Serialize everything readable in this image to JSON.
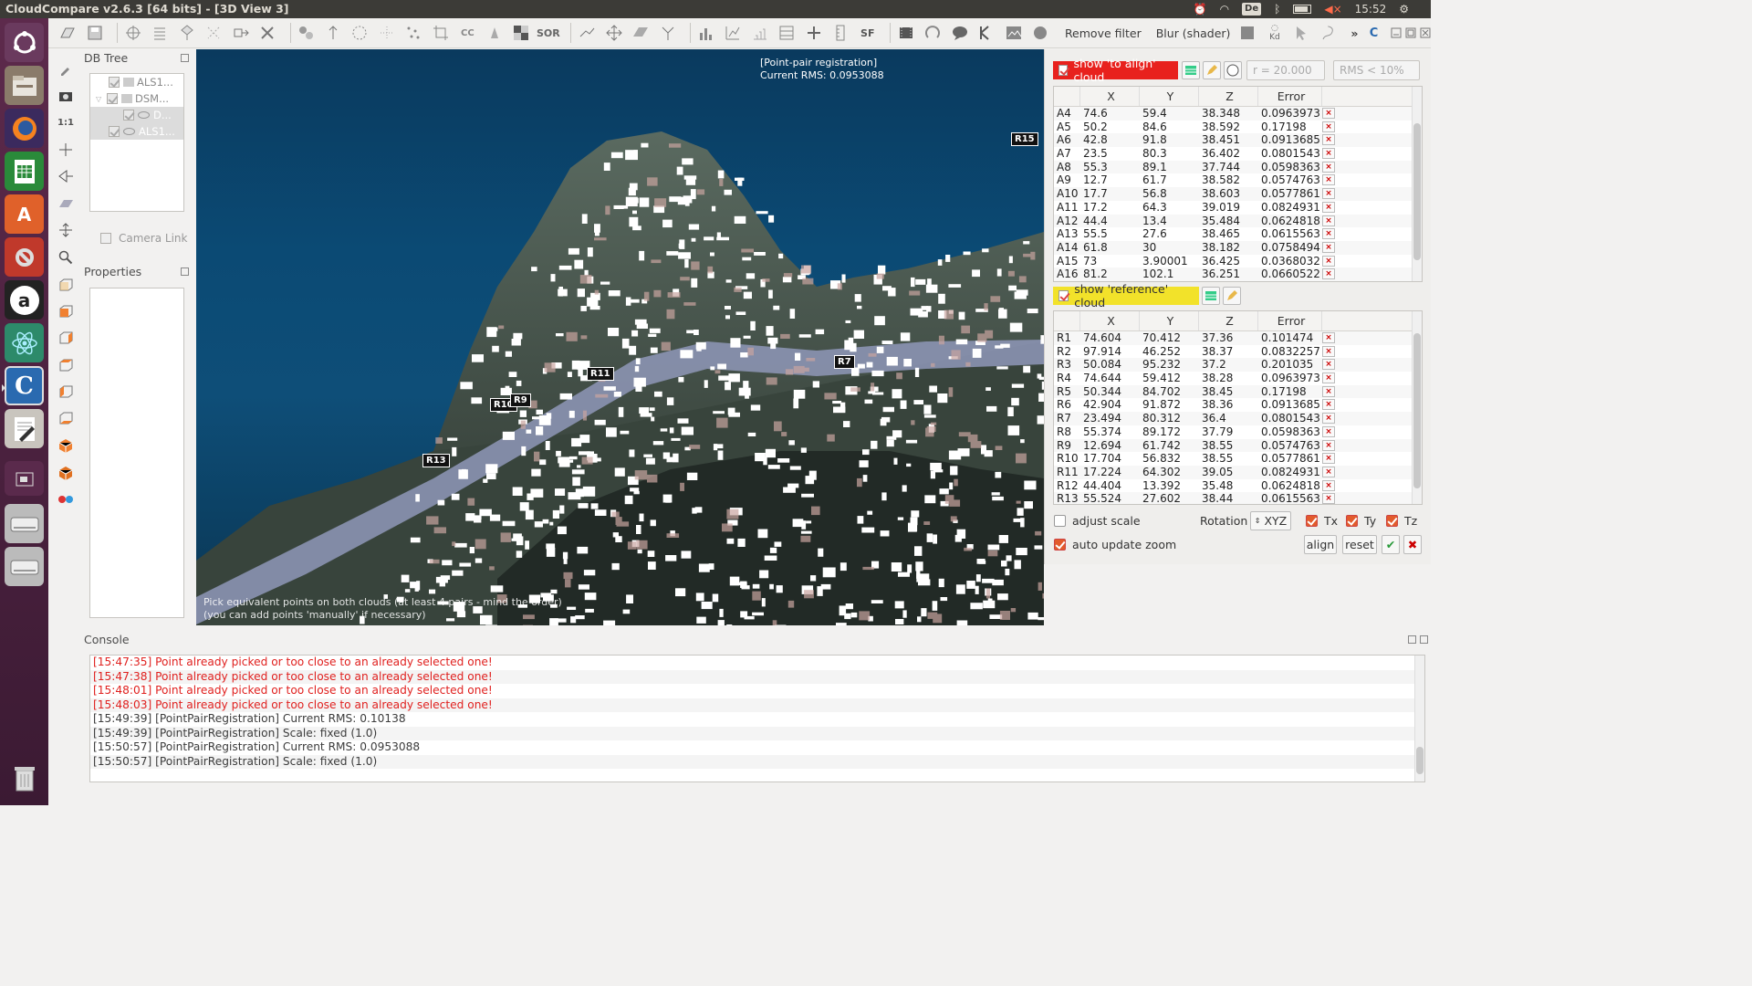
{
  "window": {
    "title": "CloudCompare v2.6.3 [64 bits] - [3D View 3]",
    "keyboard_layout": "De",
    "clock": "15:52"
  },
  "toolbar": {
    "remove_filter": "Remove filter",
    "blur_shader": "Blur (shader)",
    "kd_label": "Kd",
    "overflow": "»"
  },
  "dbtree": {
    "title": "DB Tree",
    "items": [
      {
        "label": "ALS1..."
      },
      {
        "label": "DSM..."
      },
      {
        "label": "D..."
      },
      {
        "label": "ALS1..."
      }
    ],
    "camera_link": "Camera Link"
  },
  "properties": {
    "title": "Properties"
  },
  "view3d": {
    "overlay_title": "[Point-pair registration]",
    "overlay_rms": "Current RMS: 0.0953088",
    "hint_line1": "Pick equivalent points on both clouds (at least 4 pairs - mind the order)",
    "hint_line2": "(you can add points 'manually' if necessary)",
    "markers": [
      "R15",
      "R7",
      "R11",
      "R10",
      "R9",
      "R13"
    ]
  },
  "registration": {
    "show_align_label": "show 'to align' cloud",
    "show_ref_label": "show 'reference' cloud",
    "radius": "r = 20.000",
    "rms_filter": "RMS < 10%",
    "columns": [
      "",
      "X",
      "Y",
      "Z",
      "Error"
    ],
    "align_rows": [
      [
        "A4",
        "74.6",
        "59.4",
        "38.348",
        "0.0963973"
      ],
      [
        "A5",
        "50.2",
        "84.6",
        "38.592",
        "0.17198"
      ],
      [
        "A6",
        "42.8",
        "91.8",
        "38.451",
        "0.0913685"
      ],
      [
        "A7",
        "23.5",
        "80.3",
        "36.402",
        "0.0801543"
      ],
      [
        "A8",
        "55.3",
        "89.1",
        "37.744",
        "0.0598363"
      ],
      [
        "A9",
        "12.7",
        "61.7",
        "38.582",
        "0.0574763"
      ],
      [
        "A10",
        "17.7",
        "56.8",
        "38.603",
        "0.0577861"
      ],
      [
        "A11",
        "17.2",
        "64.3",
        "39.019",
        "0.0824931"
      ],
      [
        "A12",
        "44.4",
        "13.4",
        "35.484",
        "0.0624818"
      ],
      [
        "A13",
        "55.5",
        "27.6",
        "38.465",
        "0.0615563"
      ],
      [
        "A14",
        "61.8",
        "30",
        "38.182",
        "0.0758494"
      ],
      [
        "A15",
        "73",
        "3.90001",
        "36.425",
        "0.0368032"
      ],
      [
        "A16",
        "81.2",
        "102.1",
        "36.251",
        "0.0660522"
      ]
    ],
    "ref_rows": [
      [
        "R1",
        "74.604",
        "70.412",
        "37.36",
        "0.101474"
      ],
      [
        "R2",
        "97.914",
        "46.252",
        "38.37",
        "0.0832257"
      ],
      [
        "R3",
        "50.084",
        "95.232",
        "37.2",
        "0.201035"
      ],
      [
        "R4",
        "74.644",
        "59.412",
        "38.28",
        "0.0963973"
      ],
      [
        "R5",
        "50.344",
        "84.702",
        "38.45",
        "0.17198"
      ],
      [
        "R6",
        "42.904",
        "91.872",
        "38.36",
        "0.0913685"
      ],
      [
        "R7",
        "23.494",
        "80.312",
        "36.4",
        "0.0801543"
      ],
      [
        "R8",
        "55.374",
        "89.172",
        "37.79",
        "0.0598363"
      ],
      [
        "R9",
        "12.694",
        "61.742",
        "38.55",
        "0.0574763"
      ],
      [
        "R10",
        "17.704",
        "56.832",
        "38.55",
        "0.0577861"
      ],
      [
        "R11",
        "17.224",
        "64.302",
        "39.05",
        "0.0824931"
      ],
      [
        "R12",
        "44.404",
        "13.392",
        "35.48",
        "0.0624818"
      ],
      [
        "R13",
        "55.524",
        "27.602",
        "38.44",
        "0.0615563"
      ]
    ],
    "delete_glyph": "×",
    "adjust_scale": "adjust scale",
    "auto_update_zoom": "auto update zoom",
    "rotation_label": "Rotation",
    "rotation_value": "XYZ",
    "tx": "Tx",
    "ty": "Ty",
    "tz": "Tz",
    "align_btn": "align",
    "reset_btn": "reset",
    "colors": {
      "align_red": "#e8211d",
      "ref_yellow": "#f2e22a"
    }
  },
  "console": {
    "title": "Console",
    "lines": [
      {
        "text": "[15:47:35] Point already picked or too close to an already selected one!",
        "error": true
      },
      {
        "text": "[15:47:38] Point already picked or too close to an already selected one!",
        "error": true
      },
      {
        "text": "[15:48:01] Point already picked or too close to an already selected one!",
        "error": true
      },
      {
        "text": "[15:48:03] Point already picked or too close to an already selected one!",
        "error": true
      },
      {
        "text": "[15:49:39] [PointPairRegistration] Current RMS: 0.10138",
        "error": false
      },
      {
        "text": "[15:49:39] [PointPairRegistration] Scale: fixed (1.0)",
        "error": false
      },
      {
        "text": "[15:50:57] [PointPairRegistration] Current RMS: 0.0953088",
        "error": false
      },
      {
        "text": "[15:50:57] [PointPairRegistration] Scale: fixed (1.0)",
        "error": false
      }
    ]
  }
}
